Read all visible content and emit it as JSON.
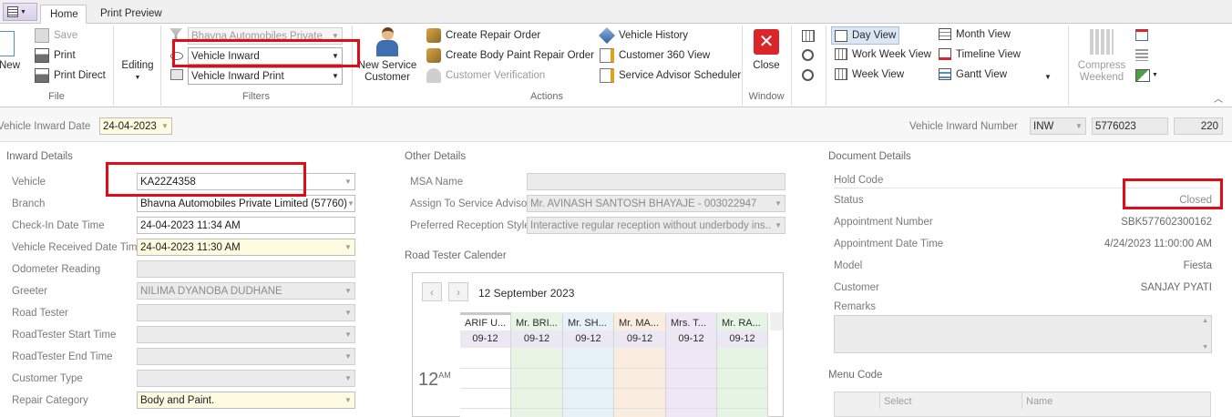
{
  "tabs": {
    "home": "Home",
    "print_preview": "Print Preview"
  },
  "ribbon": {
    "file": {
      "new": "New",
      "save": "Save",
      "print": "Print",
      "print_direct": "Print Direct",
      "caption": "File"
    },
    "editing": "Editing",
    "filters": {
      "dealer": "Bhavna Automobiles Private",
      "view": "Vehicle Inward",
      "print_view": "Vehicle Inward Print",
      "caption": "Filters"
    },
    "actions": {
      "new_service_customer_1": "New Service",
      "new_service_customer_2": "Customer",
      "create_repair_order": "Create Repair Order",
      "create_body_paint": "Create Body  Paint Repair Order",
      "customer_verification": "Customer Verification",
      "vehicle_history": "Vehicle History",
      "customer_360": "Customer 360 View",
      "advisor_scheduler": "Service Advisor Scheduler",
      "caption": "Actions"
    },
    "window": {
      "close": "Close",
      "caption": "Window"
    },
    "views": {
      "day": "Day View",
      "work_week": "Work Week View",
      "week": "Week View",
      "month": "Month View",
      "timeline": "Timeline View",
      "gantt": "Gantt View"
    },
    "compress_1": "Compress",
    "compress_2": "Weekend"
  },
  "header": {
    "inward_date_label": "Vehicle Inward Date",
    "inward_date": "24-04-2023",
    "inward_number_label": "Vehicle Inward Number",
    "prefix": "INW",
    "number": "5776023",
    "suffix": "220"
  },
  "inward": {
    "title": "Inward Details",
    "rows": [
      {
        "label": "Vehicle",
        "value": "KA22Z4358"
      },
      {
        "label": "Branch",
        "value": "Bhavna Automobiles Private Limited (57760)"
      },
      {
        "label": "Check-In Date Time",
        "value": "24-04-2023 11:34 AM"
      },
      {
        "label": "Vehicle Received Date  Time",
        "value": "24-04-2023 11:30 AM"
      },
      {
        "label": "Odometer Reading",
        "value": ""
      },
      {
        "label": "Greeter",
        "value": "NILIMA  DYANOBA  DUDHANE"
      },
      {
        "label": "Road Tester",
        "value": ""
      },
      {
        "label": "RoadTester Start Time",
        "value": ""
      },
      {
        "label": "RoadTester End Time",
        "value": ""
      },
      {
        "label": "Customer Type",
        "value": ""
      },
      {
        "label": "Repair Category",
        "value": "Body and Paint."
      }
    ]
  },
  "other": {
    "title": "Other Details",
    "msa_label": "MSA Name",
    "msa": "",
    "advisor_label": "Assign To Service Advisor",
    "advisor": "Mr. AVINASH  SANTOSH  BHAYAJE - 003022947",
    "reception_label": "Preferred Reception Style",
    "reception": "Interactive regular reception without underbody ins..."
  },
  "calendar": {
    "title": "Road Tester Calender",
    "date": "12 September 2023",
    "hour": "12",
    "ampm": "AM",
    "columns": [
      {
        "name": "ARIF U...",
        "date": "09-12",
        "color": "#ffffff"
      },
      {
        "name": "Mr. BRI...",
        "date": "09-12",
        "color": "#e9f5e4"
      },
      {
        "name": "Mr. SH...",
        "date": "09-12",
        "color": "#e6f1f8"
      },
      {
        "name": "Mr. MA...",
        "date": "09-12",
        "color": "#fbece0"
      },
      {
        "name": "Mrs. T...",
        "date": "09-12",
        "color": "#efe7f5"
      },
      {
        "name": "Mr. RA...",
        "date": "09-12",
        "color": "#e5f4e3"
      }
    ]
  },
  "document": {
    "title": "Document Details",
    "hold_code_label": "Hold Code",
    "hold_code": "",
    "status_label": "Status",
    "status": "Closed",
    "appt_no_label": "Appointment Number",
    "appt_no": "SBK577602300162",
    "appt_dt_label": "Appointment Date Time",
    "appt_dt": "4/24/2023 11:00:00 AM",
    "model_label": "Model",
    "model": "Fiesta",
    "customer_label": "Customer",
    "customer": "SANJAY PYATI",
    "remarks_label": "Remarks",
    "menu_code_label": "Menu Code",
    "col_select": "Select",
    "col_name": "Name"
  }
}
